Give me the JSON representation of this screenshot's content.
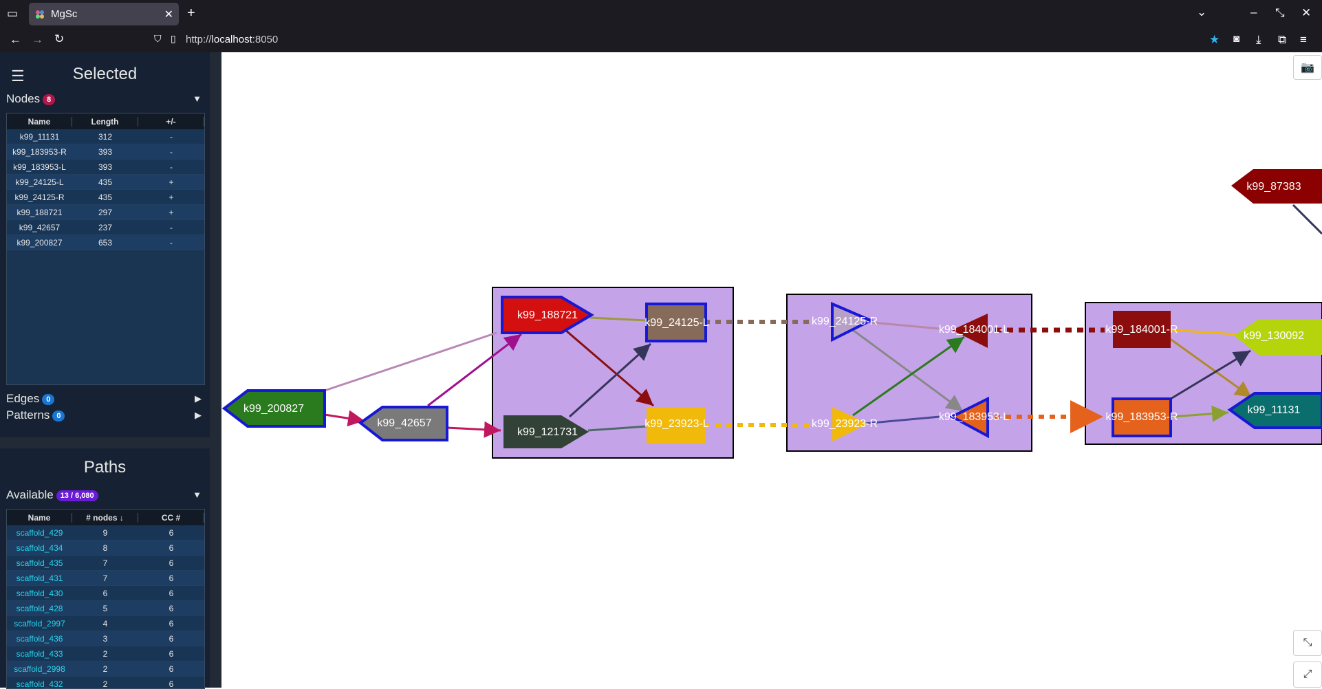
{
  "browser": {
    "tab_title": "MgSc",
    "url_prefix": "http://",
    "url_host": "localhost",
    "url_port": ":8050"
  },
  "selected": {
    "title": "Selected",
    "nodes_label": "Nodes",
    "nodes_count": "8",
    "table_headers": [
      "Name",
      "Length",
      "+/-"
    ],
    "rows": [
      [
        "k99_11131",
        "312",
        "-"
      ],
      [
        "k99_183953-R",
        "393",
        "-"
      ],
      [
        "k99_183953-L",
        "393",
        "-"
      ],
      [
        "k99_24125-L",
        "435",
        "+"
      ],
      [
        "k99_24125-R",
        "435",
        "+"
      ],
      [
        "k99_188721",
        "297",
        "+"
      ],
      [
        "k99_42657",
        "237",
        "-"
      ],
      [
        "k99_200827",
        "653",
        "-"
      ]
    ],
    "edges_label": "Edges",
    "edges_count": "0",
    "patterns_label": "Patterns",
    "patterns_count": "0"
  },
  "paths": {
    "title": "Paths",
    "available_label": "Available",
    "available_count": "13 / 6,080",
    "table_headers": [
      "Name",
      "# nodes ↓",
      "CC #"
    ],
    "rows": [
      [
        "scaffold_429",
        "9",
        "6"
      ],
      [
        "scaffold_434",
        "8",
        "6"
      ],
      [
        "scaffold_435",
        "7",
        "6"
      ],
      [
        "scaffold_431",
        "7",
        "6"
      ],
      [
        "scaffold_430",
        "6",
        "6"
      ],
      [
        "scaffold_428",
        "5",
        "6"
      ],
      [
        "scaffold_2997",
        "4",
        "6"
      ],
      [
        "scaffold_436",
        "3",
        "6"
      ],
      [
        "scaffold_433",
        "2",
        "6"
      ],
      [
        "scaffold_2998",
        "2",
        "6"
      ],
      [
        "scaffold_432",
        "2",
        "6"
      ]
    ]
  },
  "graph": {
    "group_color": "#c5a3e8",
    "node_labels": {
      "n200827": "k99_200827",
      "n42657": "k99_42657",
      "n188721": "k99_188721",
      "n121731": "k99_121731",
      "n24125L": "k99_24125-L",
      "n23923L": "k99_23923-L",
      "n24125R": "k99_24125-R",
      "n23923R": "k99_23923-R",
      "n184001L": "k99_184001-L",
      "n183953L": "k99_183953-L",
      "n184001R": "k99_184001-R",
      "n183953R": "k99_183953-R",
      "n130092": "k99_130092",
      "n11131": "k99_11131",
      "n87383": "k99_87383"
    },
    "node_colors": {
      "n200827": "#2a7a1e",
      "n42657": "#7a7a7a",
      "n188721": "#d40f0f",
      "n121731": "#334237",
      "n24125L": "#876b5a",
      "n23923L": "#f1b90a",
      "n24125R": "#b7a0c7",
      "n23923R": "#f1b90a",
      "n184001L": "#8b0d0d",
      "n183953L": "#e4621b",
      "n184001R": "#8b0d0d",
      "n183953R": "#e4621b",
      "n130092": "#b5d40b",
      "n11131": "#0a6e6c",
      "n87383": "#8b0000"
    },
    "selected_outline": "#1717d6"
  },
  "icons": {
    "camera": "camera-icon",
    "zoom_fit": "shrink-icon",
    "zoom_expand": "expand-icon"
  }
}
